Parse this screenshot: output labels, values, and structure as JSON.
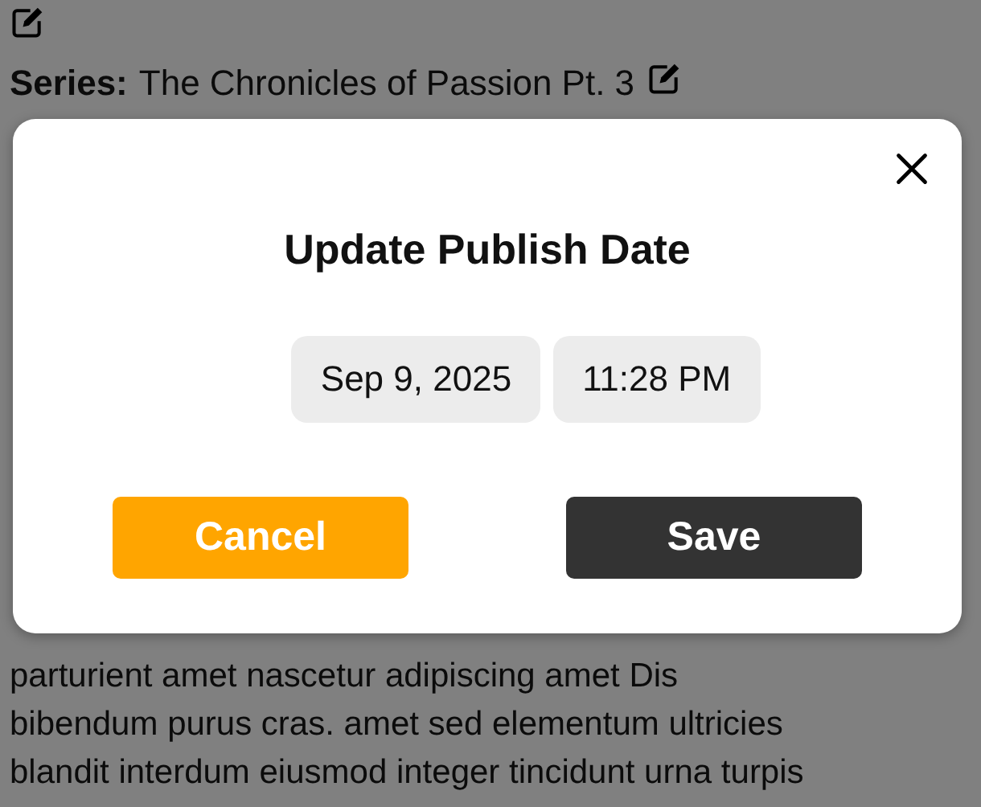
{
  "page": {
    "series_label": "Series:",
    "series": "The Chronicles of Passion Pt. 3",
    "description_lines": [
      "parturient amet nascetur adipiscing amet Dis",
      "bibendum purus cras. amet sed elementum ultricies",
      "blandit interdum eiusmod integer tincidunt urna turpis"
    ]
  },
  "dialog": {
    "title": "Update Publish Date",
    "date": "Sep 9, 2025",
    "time": "11:28 PM",
    "buttons": [
      {
        "label": "Cancel",
        "kind": "cancel"
      },
      {
        "label": "Save",
        "kind": "save"
      }
    ]
  }
}
